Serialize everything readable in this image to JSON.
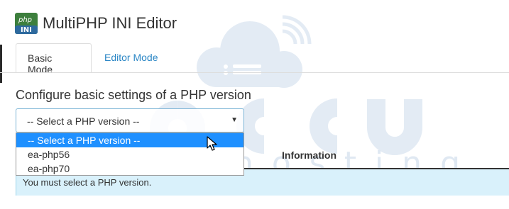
{
  "app": {
    "title": "MultiPHP INI Editor",
    "logo_text": "php INI"
  },
  "tabs": [
    {
      "label": "Basic Mode",
      "active": true
    },
    {
      "label": "Editor Mode",
      "active": false
    }
  ],
  "section": {
    "heading": "Configure basic settings of a PHP version"
  },
  "version_select": {
    "value": "-- Select a PHP version --",
    "options": [
      "-- Select a PHP version --",
      "ea-php56",
      "ea-php70"
    ],
    "highlighted_index": 0
  },
  "table": {
    "column_header": "Information"
  },
  "alert": {
    "message": "You must select a PHP version."
  },
  "watermark": {
    "text": "web hosting",
    "brand": "accu"
  },
  "colors": {
    "link": "#2a86c5",
    "highlight": "#1e90ff",
    "alert_bg": "#d9f1fb",
    "select_border": "#7bb4d6"
  }
}
